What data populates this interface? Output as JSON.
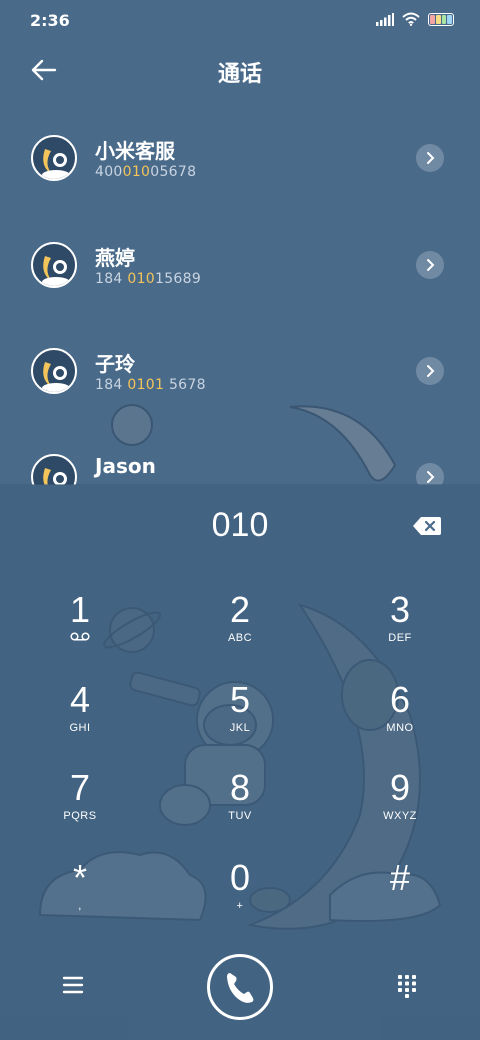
{
  "status_bar": {
    "time": "2:36"
  },
  "header": {
    "title": "通话"
  },
  "contacts": [
    {
      "name": "小米客服",
      "num_pre": "400",
      "num_hl": "010",
      "num_post": "05678"
    },
    {
      "name": "燕婷",
      "num_pre": "184 ",
      "num_hl": "010",
      "num_post": "15689"
    },
    {
      "name": "子玲",
      "num_pre": "184 ",
      "num_hl": "0101",
      "num_post": " 5678"
    },
    {
      "name": "Jason",
      "num_pre": "",
      "num_hl": "",
      "num_post": ""
    }
  ],
  "dialer": {
    "input": "010",
    "keys": [
      {
        "digit": "1",
        "letters": ""
      },
      {
        "digit": "2",
        "letters": "ABC"
      },
      {
        "digit": "3",
        "letters": "DEF"
      },
      {
        "digit": "4",
        "letters": "GHI"
      },
      {
        "digit": "5",
        "letters": "JKL"
      },
      {
        "digit": "6",
        "letters": "MNO"
      },
      {
        "digit": "7",
        "letters": "PQRS"
      },
      {
        "digit": "8",
        "letters": "TUV"
      },
      {
        "digit": "9",
        "letters": "WXYZ"
      },
      {
        "digit": "*",
        "letters": ","
      },
      {
        "digit": "0",
        "letters": "+"
      },
      {
        "digit": "#",
        "letters": ""
      }
    ]
  },
  "colors": {
    "background": "#4a6a8a",
    "highlight": "#f3c45a",
    "text": "#ffffff",
    "battery": [
      "#f6a5a5",
      "#f6dd86",
      "#a9e6a2",
      "#9fd4f3"
    ]
  },
  "icons": {
    "back": "arrow-left-icon",
    "detail": "chevron-right-icon",
    "backspace": "backspace-icon",
    "voicemail": "voicemail-icon",
    "menu": "hamburger-menu-icon",
    "call": "phone-icon",
    "keypad": "dialpad-icon",
    "signal": "signal-icon",
    "wifi": "wifi-icon",
    "battery": "battery-icon"
  }
}
